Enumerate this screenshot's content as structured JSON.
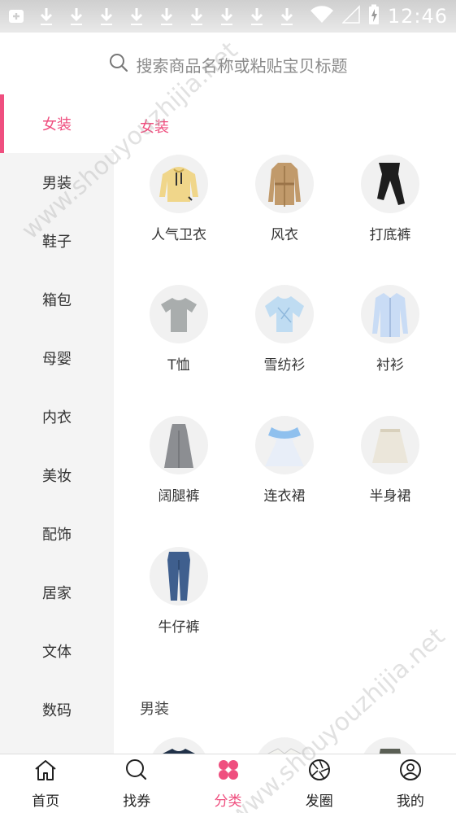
{
  "status_bar": {
    "time": "12:46",
    "left_icons": [
      "add-notification-icon",
      "download-icon",
      "download-icon",
      "download-icon",
      "download-icon",
      "download-icon",
      "download-icon",
      "download-icon",
      "download-icon",
      "download-icon"
    ],
    "right_icons": [
      "wifi-icon",
      "signal-icon",
      "battery-charging-icon"
    ]
  },
  "search": {
    "placeholder": "搜索商品名称或粘贴宝贝标题"
  },
  "sidebar": {
    "items": [
      {
        "label": "女装",
        "active": true
      },
      {
        "label": "男装"
      },
      {
        "label": "鞋子"
      },
      {
        "label": "箱包"
      },
      {
        "label": "母婴"
      },
      {
        "label": "内衣"
      },
      {
        "label": "美妆"
      },
      {
        "label": "配饰"
      },
      {
        "label": "居家"
      },
      {
        "label": "文体"
      },
      {
        "label": "数码"
      }
    ]
  },
  "sections": [
    {
      "title": "女装",
      "items": [
        {
          "label": "人气卫衣",
          "icon": "hoodie-icon"
        },
        {
          "label": "风衣",
          "icon": "trench-coat-icon"
        },
        {
          "label": "打底裤",
          "icon": "leggings-icon"
        },
        {
          "label": "T恤",
          "icon": "tshirt-icon"
        },
        {
          "label": "雪纺衫",
          "icon": "chiffon-blouse-icon"
        },
        {
          "label": "衬衫",
          "icon": "shirt-icon"
        },
        {
          "label": "阔腿裤",
          "icon": "wide-leg-pants-icon"
        },
        {
          "label": "连衣裙",
          "icon": "dress-icon"
        },
        {
          "label": "半身裙",
          "icon": "skirt-icon"
        },
        {
          "label": "牛仔裤",
          "icon": "jeans-icon"
        }
      ]
    },
    {
      "title": "男装",
      "items": [
        {
          "icon": "mens-top-icon"
        },
        {
          "icon": "mens-shirt-icon"
        },
        {
          "icon": "mens-pants-icon"
        }
      ]
    }
  ],
  "bottom_nav": {
    "items": [
      {
        "label": "首页",
        "icon": "home-icon"
      },
      {
        "label": "找券",
        "icon": "search-coupon-icon"
      },
      {
        "label": "分类",
        "icon": "category-icon",
        "active": true
      },
      {
        "label": "发圈",
        "icon": "shutter-icon"
      },
      {
        "label": "我的",
        "icon": "profile-icon"
      }
    ]
  },
  "watermark": {
    "text": "www.shouyouzhijia.net"
  },
  "colors": {
    "accent": "#ef4f7f",
    "sidebar_bg": "#f4f4f4",
    "status_bar_bg": "#d8d8d8"
  }
}
